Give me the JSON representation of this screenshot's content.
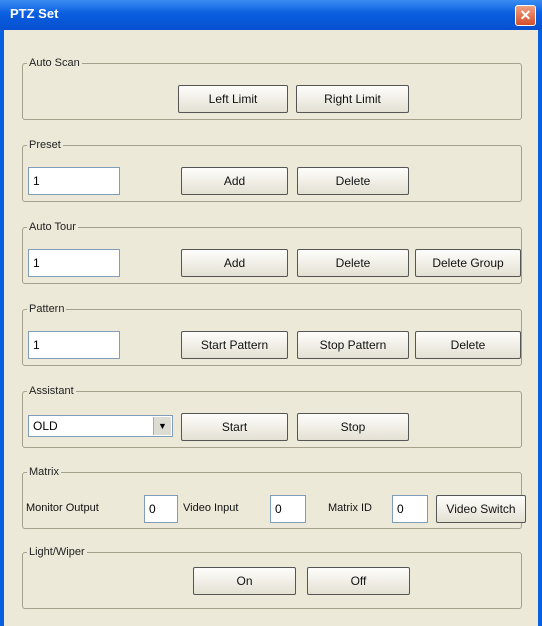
{
  "window": {
    "title": "PTZ Set",
    "close_symbol": "✕"
  },
  "auto_scan": {
    "legend": "Auto Scan",
    "left_limit": "Left Limit",
    "right_limit": "Right Limit"
  },
  "preset": {
    "legend": "Preset",
    "value": "1",
    "add": "Add",
    "delete": "Delete"
  },
  "auto_tour": {
    "legend": "Auto Tour",
    "value": "1",
    "add": "Add",
    "delete": "Delete",
    "delete_group": "Delete Group"
  },
  "pattern": {
    "legend": "Pattern",
    "value": "1",
    "start": "Start Pattern",
    "stop": "Stop Pattern",
    "delete": "Delete"
  },
  "assistant": {
    "legend": "Assistant",
    "selected": "OLD",
    "start": "Start",
    "stop": "Stop"
  },
  "matrix": {
    "legend": "Matrix",
    "monitor_label": "Monitor Output",
    "monitor_value": "0",
    "video_input_label": "Video Input",
    "video_input_value": "0",
    "matrix_id_label": "Matrix ID",
    "matrix_id_value": "0",
    "video_switch": "Video Switch"
  },
  "light_wiper": {
    "legend": "Light/Wiper",
    "on": "On",
    "off": "Off"
  }
}
